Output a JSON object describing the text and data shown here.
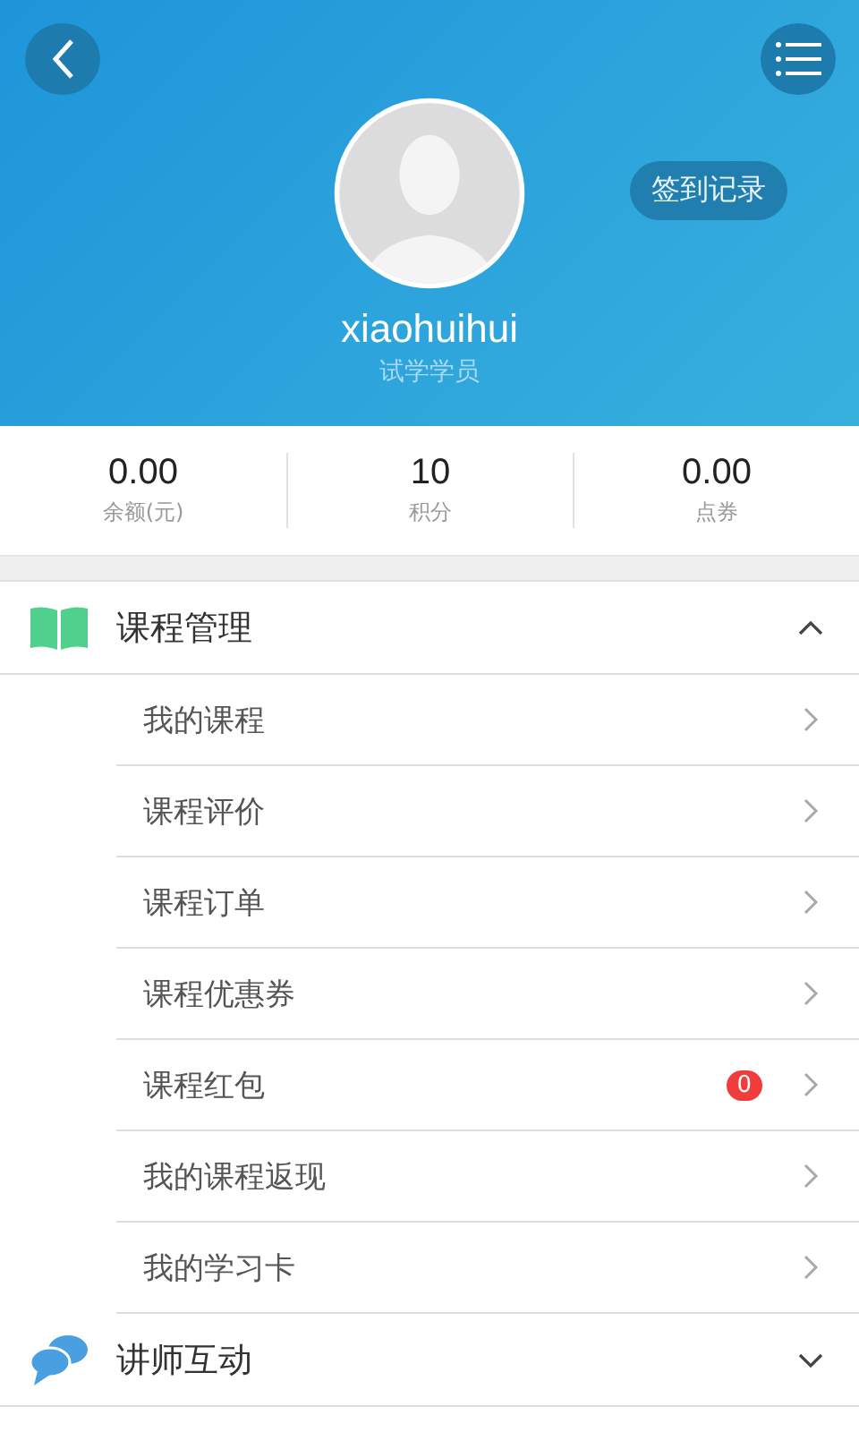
{
  "header": {
    "username": "xiaohuihui",
    "role": "试学学员",
    "checkin_button": "签到记录"
  },
  "stats": [
    {
      "value": "0.00",
      "label": "余额(元)"
    },
    {
      "value": "10",
      "label": "积分"
    },
    {
      "value": "0.00",
      "label": "点券"
    }
  ],
  "sections": [
    {
      "kind": "book",
      "title": "课程管理",
      "expanded": true,
      "items": [
        {
          "label": "我的课程"
        },
        {
          "label": "课程评价"
        },
        {
          "label": "课程订单"
        },
        {
          "label": "课程优惠券"
        },
        {
          "label": "课程红包",
          "badge": "0"
        },
        {
          "label": "我的课程返现"
        },
        {
          "label": "我的学习卡"
        }
      ]
    },
    {
      "kind": "chat",
      "title": "讲师互动",
      "expanded": false
    }
  ]
}
